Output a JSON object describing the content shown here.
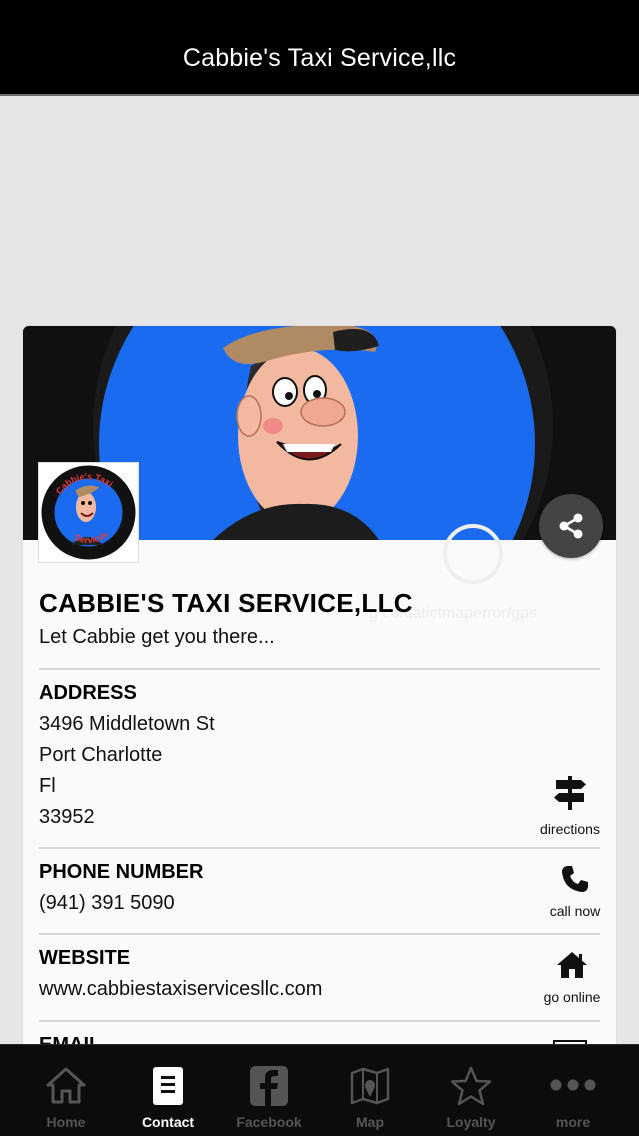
{
  "header": {
    "title": "Cabbie's Taxi Service,llc"
  },
  "card": {
    "business_name": "CABBIE'S TAXI SERVICE,LLC",
    "tagline": "Let Cabbie get you there...",
    "logo_text_top": "Cabbie's Taxi",
    "logo_text_bottom": "Services",
    "ghost_text": "g contatictmaperror/gps",
    "address": {
      "label": "ADDRESS",
      "lines": [
        "3496 Middletown St",
        "Port Charlotte",
        "Fl",
        "33952"
      ],
      "action_label": "directions"
    },
    "phone": {
      "label": "PHONE NUMBER",
      "value": "(941) 391 5090",
      "action_label": "call now"
    },
    "website": {
      "label": "WEBSITE",
      "value": "www.cabbiestaxiservicesllc.com",
      "action_label": "go online"
    },
    "email": {
      "label": "EMAIL"
    }
  },
  "tabs": [
    {
      "label": "Home",
      "icon": "home-icon",
      "active": false
    },
    {
      "label": "Contact",
      "icon": "contact-icon",
      "active": true
    },
    {
      "label": "Facebook",
      "icon": "facebook-icon",
      "active": false
    },
    {
      "label": "Map",
      "icon": "map-icon",
      "active": false
    },
    {
      "label": "Loyalty",
      "icon": "star-icon",
      "active": false
    },
    {
      "label": "more",
      "icon": "more-icon",
      "active": false
    }
  ],
  "colors": {
    "cover_blue": "#1a6bf0",
    "tab_active": "#ffffff",
    "tab_inactive": "#555555"
  }
}
